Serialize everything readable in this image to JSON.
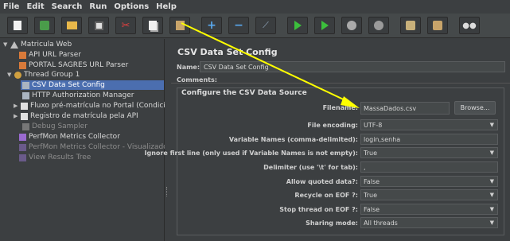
{
  "menu": [
    "File",
    "Edit",
    "Search",
    "Run",
    "Options",
    "Help"
  ],
  "toolbar": [
    "new-icon",
    "templates-icon",
    "open-icon",
    "save-icon",
    "cut-icon",
    "copy-icon",
    "paste-icon",
    "expand-icon",
    "collapse-icon",
    "toggle-icon",
    "start-icon",
    "start-no-pauses-icon",
    "stop-icon",
    "shutdown-icon",
    "clear-icon",
    "clear-all-icon",
    "search-icon"
  ],
  "tree": {
    "items": [
      {
        "label": "Matricula Web"
      },
      {
        "label": "API URL Parser"
      },
      {
        "label": "PORTAL SAGRES URL Parser"
      },
      {
        "label": "Thread Group 1"
      },
      {
        "label": "CSV Data Set Config"
      },
      {
        "label": "HTTP Authorization Manager"
      },
      {
        "label": "Fluxo pré-matrícula no Portal (Condiciona"
      },
      {
        "label": "Registro de matrícula pela API"
      },
      {
        "label": "Debug Sampler"
      },
      {
        "label": "PerfMon Metrics Collector"
      },
      {
        "label": "PerfMon Metrics Collector - Visualizador"
      },
      {
        "label": "View Results Tree"
      }
    ]
  },
  "panel": {
    "title": "CSV Data Set Config",
    "name_label": "Name:",
    "name_value": "CSV Data Set Config",
    "comments_label": "Comments:",
    "group_title": "Configure the CSV Data Source",
    "browse": "Browse...",
    "rows": [
      {
        "label": "Filename:",
        "value": "MassaDados.csv"
      },
      {
        "label": "File encoding:",
        "value": "UTF-8"
      },
      {
        "label": "Variable Names (comma-delimited):",
        "value": "login,senha"
      },
      {
        "label": "Ignore first line (only used if Variable Names is not empty):",
        "value": "True"
      },
      {
        "label": "Delimiter (use '\\t' for tab):",
        "value": ","
      },
      {
        "label": "Allow quoted data?:",
        "value": "False"
      },
      {
        "label": "Recycle on EOF ?:",
        "value": "True"
      },
      {
        "label": "Stop thread on EOF ?:",
        "value": "False"
      },
      {
        "label": "Sharing mode:",
        "value": "All threads"
      }
    ]
  },
  "colors": {
    "selection": "#4b6eaf",
    "arrow": "#ffff00",
    "background": "#3c3f41"
  }
}
